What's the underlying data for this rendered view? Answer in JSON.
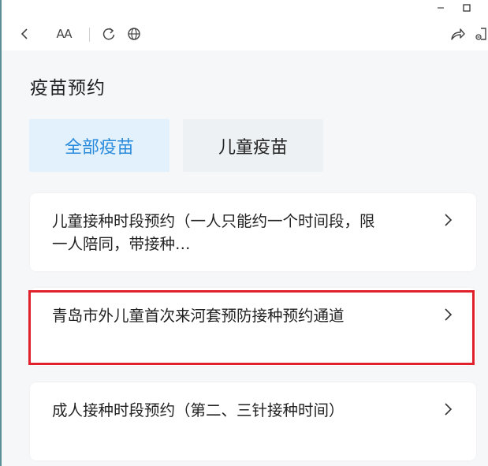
{
  "window": {
    "controls": [
      {
        "name": "minimize",
        "icon": "minimize-icon"
      },
      {
        "name": "maximize",
        "icon": "maximize-icon"
      }
    ]
  },
  "toolbar": {
    "icons": [
      "back-icon",
      "font-size-icon",
      "refresh-icon",
      "globe-icon",
      "share-icon",
      "exit-icon"
    ],
    "font_size_glyph": "AA"
  },
  "page": {
    "title": "疫苗预约"
  },
  "tabs": [
    {
      "label": "全部疫苗",
      "selected": true
    },
    {
      "label": "儿童疫苗",
      "selected": false
    }
  ],
  "cards": [
    {
      "text": "儿童接种时段预约（一人只能约一个时间段，限一人陪同，带接种…"
    },
    {
      "text": "青岛市外儿童首次来河套预防接种预约通道",
      "highlighted": true
    },
    {
      "text": "成人接种时段预约（第二、三针接种时间）"
    }
  ],
  "colors": {
    "accent": "#2a8bdd",
    "selected_tab_bg": "#e3f1fc",
    "unselected_tab_bg": "#edf1f4",
    "highlight_border": "#e0212b",
    "page_bg": "#f6f7f9"
  }
}
